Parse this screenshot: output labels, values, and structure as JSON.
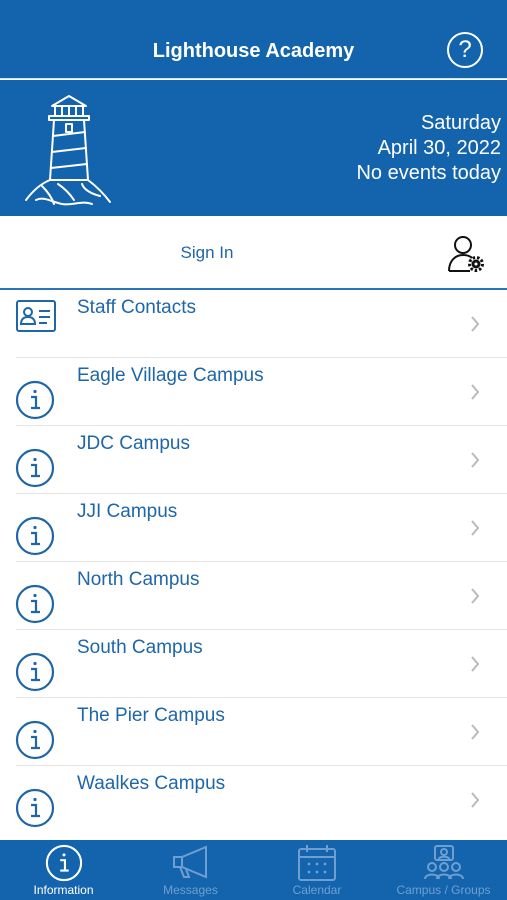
{
  "header": {
    "title": "Lighthouse Academy",
    "help_icon": "question-circle-icon"
  },
  "banner": {
    "day": "Saturday",
    "date": "April 30, 2022",
    "events": "No events today",
    "logo_icon": "lighthouse-icon"
  },
  "signin": {
    "label": "Sign In",
    "icon": "user-gear-icon"
  },
  "list": {
    "items": [
      {
        "label": "Staff Contacts",
        "icon": "contact-card-icon"
      },
      {
        "label": "Eagle Village Campus",
        "icon": "info-circle-icon"
      },
      {
        "label": "JDC Campus",
        "icon": "info-circle-icon"
      },
      {
        "label": "JJI Campus",
        "icon": "info-circle-icon"
      },
      {
        "label": "North Campus",
        "icon": "info-circle-icon"
      },
      {
        "label": "South Campus",
        "icon": "info-circle-icon"
      },
      {
        "label": "The Pier Campus",
        "icon": "info-circle-icon"
      },
      {
        "label": "Waalkes Campus",
        "icon": "info-circle-icon"
      }
    ]
  },
  "tabbar": {
    "tabs": [
      {
        "label": "Information",
        "icon": "info-circle-icon",
        "active": true
      },
      {
        "label": "Messages",
        "icon": "megaphone-icon",
        "active": false
      },
      {
        "label": "Calendar",
        "icon": "calendar-icon",
        "active": false
      },
      {
        "label": "Campus / Groups",
        "icon": "group-icon",
        "active": false
      }
    ]
  },
  "colors": {
    "primary": "#1464ad",
    "accent_text": "#1f66a8",
    "inactive_tab": "#6f9fd0"
  }
}
